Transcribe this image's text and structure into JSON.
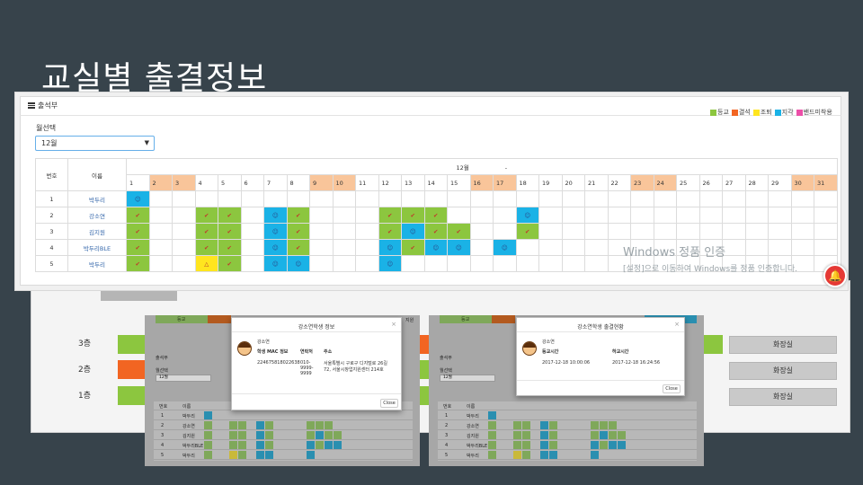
{
  "slide_title": "교실별 출결정보",
  "panel": {
    "title": "출석부",
    "month_label": "월선택",
    "month_value": "12월",
    "legend": [
      {
        "label": "등교",
        "color": "#8cc63f"
      },
      {
        "label": "결석",
        "color": "#f26522"
      },
      {
        "label": "조퇴",
        "color": "#ffe51f"
      },
      {
        "label": "지각",
        "color": "#1ab2e6"
      },
      {
        "label": "밴드미착용",
        "color": "#ec4fa8"
      }
    ],
    "table": {
      "col_no": "번호",
      "col_name": "이름",
      "month_header": "12월",
      "month_dot": "-",
      "days": [
        "1",
        "2",
        "3",
        "4",
        "5",
        "6",
        "7",
        "8",
        "9",
        "10",
        "11",
        "12",
        "13",
        "14",
        "15",
        "16",
        "17",
        "18",
        "19",
        "20",
        "21",
        "22",
        "23",
        "24",
        "25",
        "26",
        "27",
        "28",
        "29",
        "30",
        "31"
      ],
      "holidays": [
        "2",
        "3",
        "9",
        "10",
        "16",
        "17",
        "23",
        "24",
        "30",
        "31"
      ],
      "rows": [
        {
          "no": "1",
          "name": "박두리",
          "cells": {
            "1": "b"
          }
        },
        {
          "no": "2",
          "name": "강소연",
          "cells": {
            "1": "g",
            "4": "g",
            "5": "g",
            "7": "b",
            "8": "g",
            "12": "g",
            "13": "g",
            "14": "g",
            "18": "b"
          }
        },
        {
          "no": "3",
          "name": "김지원",
          "cells": {
            "1": "g",
            "4": "g",
            "5": "g",
            "7": "b",
            "8": "g",
            "12": "g",
            "13": "b",
            "14": "g",
            "15": "g",
            "18": "g"
          }
        },
        {
          "no": "4",
          "name": "박두리BLE",
          "cells": {
            "1": "g",
            "4": "g",
            "5": "g",
            "7": "b",
            "8": "g",
            "12": "b",
            "13": "g",
            "14": "b",
            "15": "b",
            "17": "b"
          }
        },
        {
          "no": "5",
          "name": "박두리",
          "cells": {
            "1": "g",
            "4": "y",
            "5": "g",
            "7": "b",
            "8": "b",
            "12": "b"
          }
        }
      ],
      "marks": {
        "g": "✔",
        "b": "☺",
        "y": "△"
      }
    }
  },
  "watermark": {
    "line1": "Windows 정품 인증",
    "line2": "[설정]으로 이동하여 Windows를 정품 인증합니다."
  },
  "building": {
    "floors": [
      {
        "label": "3층",
        "restroom": "화장실"
      },
      {
        "label": "2층",
        "restroom": "화장실"
      },
      {
        "label": "1층",
        "restroom": "화장실"
      }
    ]
  },
  "shot1": {
    "modal_title": "강소연학생 정보",
    "student_name": "강소연",
    "col1": "학생 MAC 정보",
    "col2": "연락처",
    "col3": "주소",
    "mac": "224675818022638",
    "phone": "010-9999-9999",
    "address": "서울특별시 구로구 디지털로 26길 72, 서울시창업지원센터 214호",
    "close": "Close",
    "top_label": "등교",
    "side_label": "지원",
    "panel_title": "출석부",
    "month_label": "월선택",
    "month_value": "12월",
    "names": [
      "박두리",
      "강소연",
      "김지원",
      "박두리BLE",
      "박두리"
    ],
    "col_no": "번호",
    "col_name": "이름"
  },
  "shot2": {
    "modal_title": "강소연학생 출결현황",
    "student_name": "강소연",
    "col1": "등교시간",
    "col2": "하교시간",
    "in_time": "2017-12-18 10:00:06",
    "out_time": "2017-12-18 16:24:56",
    "close": "Close",
    "top_label": "등교",
    "panel_title": "출석부",
    "month_label": "월선택",
    "month_value": "12월",
    "names": [
      "박두리",
      "강소연",
      "김지원",
      "박두리BLE",
      "박두리"
    ],
    "col_no": "번호",
    "col_name": "이름"
  },
  "colors": {
    "green": "#8cc63f",
    "orange": "#f26522",
    "blue": "#1ab2e6",
    "yellow": "#ffe51f",
    "holiday": "#f9c59a"
  }
}
